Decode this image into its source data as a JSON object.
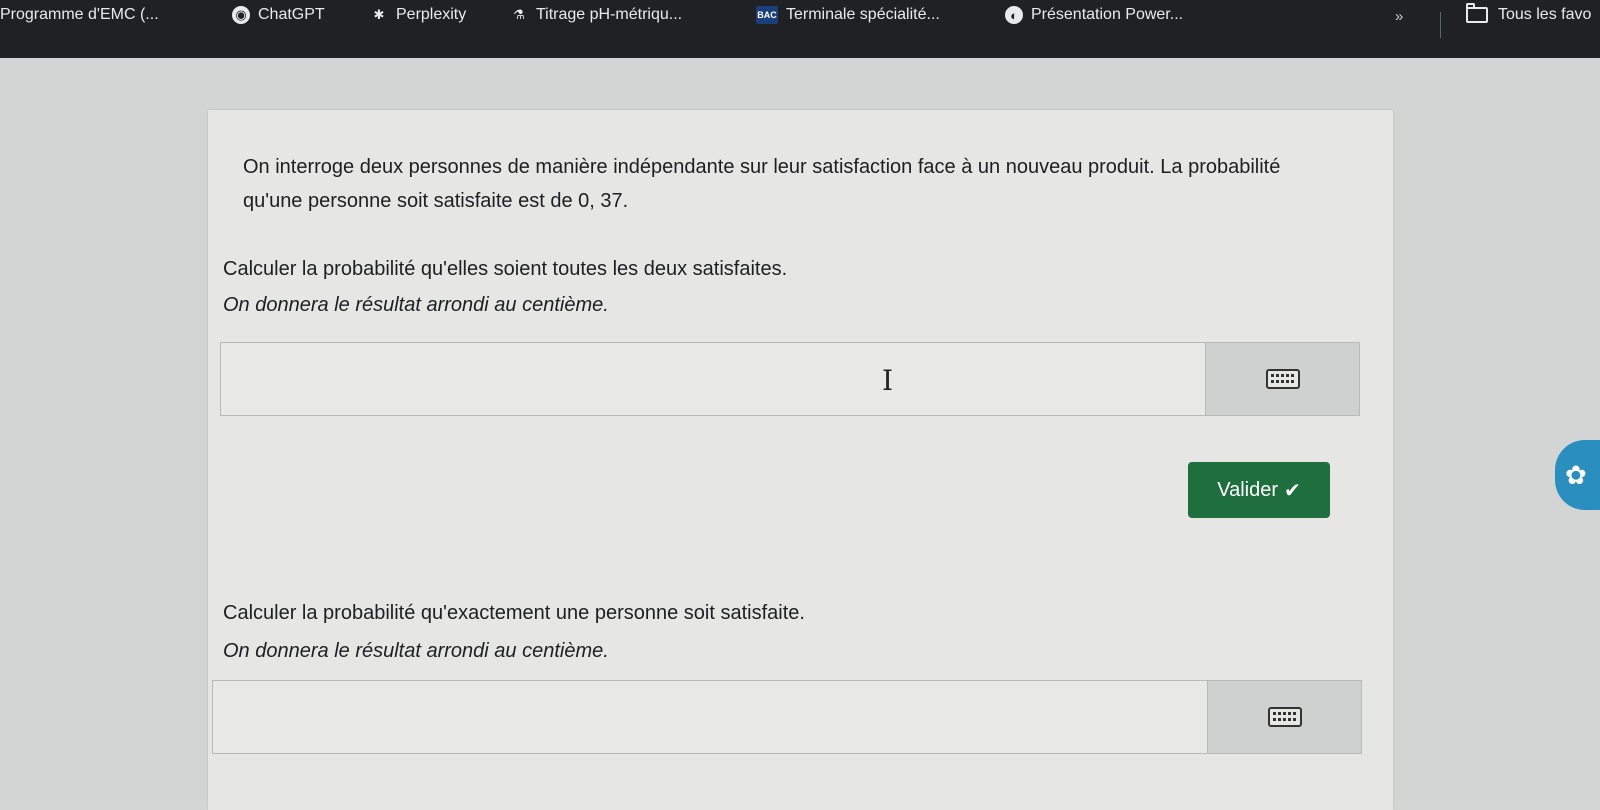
{
  "bookmarks": [
    {
      "label": "Programme d'EMC (...",
      "icon": "emc-icon"
    },
    {
      "label": "ChatGPT",
      "icon": "chatgpt-icon"
    },
    {
      "label": "Perplexity",
      "icon": "perplexity-icon"
    },
    {
      "label": "Titrage pH-métriqu...",
      "icon": "flask-icon"
    },
    {
      "label": "Terminale spécialité...",
      "icon": "bac-icon"
    },
    {
      "label": "Présentation Power...",
      "icon": "globe-icon"
    }
  ],
  "bookmarks_overflow": "»",
  "bookmarks_folder": "Tous les favo",
  "exercise": {
    "intro": "On interroge deux personnes de manière indépendante sur leur satisfaction face à un nouveau produit. La probabilité qu'une personne soit satisfaite est de 0, 37.",
    "q1": {
      "title": "Calculer la probabilité qu'elles soient toutes les deux satisfaites.",
      "hint": "On donnera le résultat arrondi au centième.",
      "value": ""
    },
    "valider_label": "Valider",
    "q2": {
      "title": "Calculer la probabilité qu'exactement une personne soit satisfaite.",
      "hint": "On donnera le résultat arrondi au centième.",
      "value": ""
    }
  },
  "colors": {
    "bookmarks_bg": "#202124",
    "valider_bg": "#1f6e3d",
    "card_bg": "#e6e6e4"
  }
}
